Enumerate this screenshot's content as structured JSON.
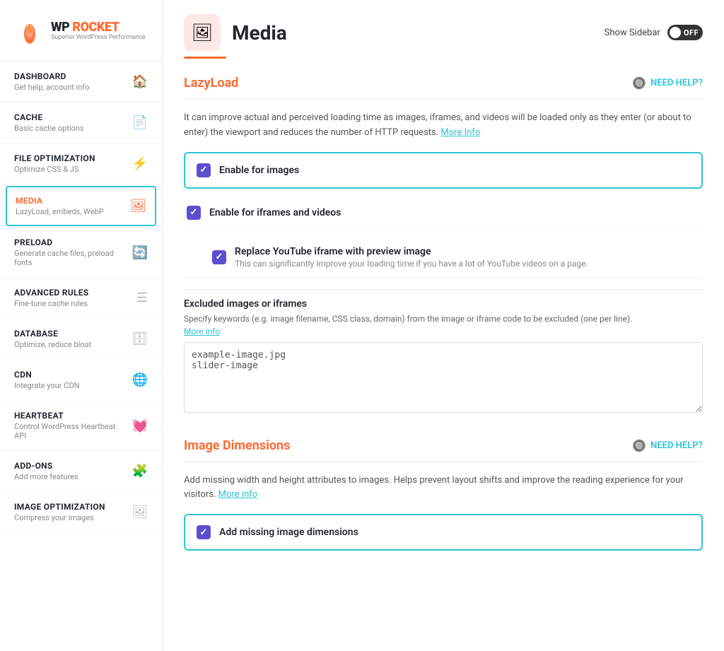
{
  "logo": {
    "wp": "WP",
    "rocket": "ROCKET",
    "tagline": "Superior WordPress Performance"
  },
  "sidebar": {
    "items": [
      {
        "id": "dashboard",
        "title": "DASHBOARD",
        "sub": "Get help, account info",
        "icon": "🏠",
        "active": false
      },
      {
        "id": "cache",
        "title": "CACHE",
        "sub": "Basic cache options",
        "icon": "📄",
        "active": false
      },
      {
        "id": "file-optimization",
        "title": "FILE OPTIMIZATION",
        "sub": "Optimize CSS & JS",
        "icon": "⚡",
        "active": false
      },
      {
        "id": "media",
        "title": "MEDIA",
        "sub": "LazyLoad, embeds, WebP",
        "icon": "🖼",
        "active": true
      },
      {
        "id": "preload",
        "title": "PRELOAD",
        "sub": "Generate cache files, preload fonts",
        "icon": "🔄",
        "active": false
      },
      {
        "id": "advanced-rules",
        "title": "ADVANCED RULES",
        "sub": "Fine-tune cache rules",
        "icon": "☰",
        "active": false
      },
      {
        "id": "database",
        "title": "DATABASE",
        "sub": "Optimize, reduce bloat",
        "icon": "🗄",
        "active": false
      },
      {
        "id": "cdn",
        "title": "CDN",
        "sub": "Integrate your CDN",
        "icon": "🌐",
        "active": false
      },
      {
        "id": "heartbeat",
        "title": "HEARTBEAT",
        "sub": "Control WordPress Heartbeat API",
        "icon": "💓",
        "active": false
      },
      {
        "id": "add-ons",
        "title": "ADD-ONS",
        "sub": "Add more features",
        "icon": "🧩",
        "active": false
      },
      {
        "id": "image-optimization",
        "title": "IMAGE OPTIMIZATION",
        "sub": "Compress your images",
        "icon": "🖼",
        "active": false
      }
    ]
  },
  "page": {
    "title": "Media",
    "icon": "🖼",
    "sidebar_toggle_label": "Show Sidebar",
    "toggle_state": "OFF"
  },
  "lazyload": {
    "section_title": "LazyLoad",
    "need_help": "NEED HELP?",
    "description": "It can improve actual and perceived loading time as images, iframes, and videos will be loaded only as they enter (or about to enter) the viewport and reduces the number of HTTP requests.",
    "more_info_link": "More Info",
    "options": [
      {
        "id": "enable-images",
        "label": "Enable for images",
        "checked": true,
        "highlighted": true
      },
      {
        "id": "enable-iframes",
        "label": "Enable for iframes and videos",
        "checked": true,
        "highlighted": false
      }
    ],
    "sub_options": [
      {
        "id": "replace-youtube",
        "label": "Replace YouTube iframe with preview image",
        "sub": "This can significantly improve your loading time if you have a lot of YouTube videos on a page.",
        "checked": true
      }
    ],
    "excluded_label": "Excluded images or iframes",
    "excluded_desc": "Specify keywords (e.g. image filename, CSS class, domain) from the image or iframe code to be excluded (one per line).",
    "excluded_more_info": "More info",
    "excluded_placeholder": "example-image.jpg\nslider-image"
  },
  "image_dimensions": {
    "section_title": "Image Dimensions",
    "need_help": "NEED HELP?",
    "description": "Add missing width and height attributes to images. Helps prevent layout shifts and improve the reading experience for your visitors.",
    "more_info_link": "More info",
    "options": [
      {
        "id": "add-missing-dimensions",
        "label": "Add missing image dimensions",
        "checked": true,
        "highlighted": true
      }
    ]
  }
}
